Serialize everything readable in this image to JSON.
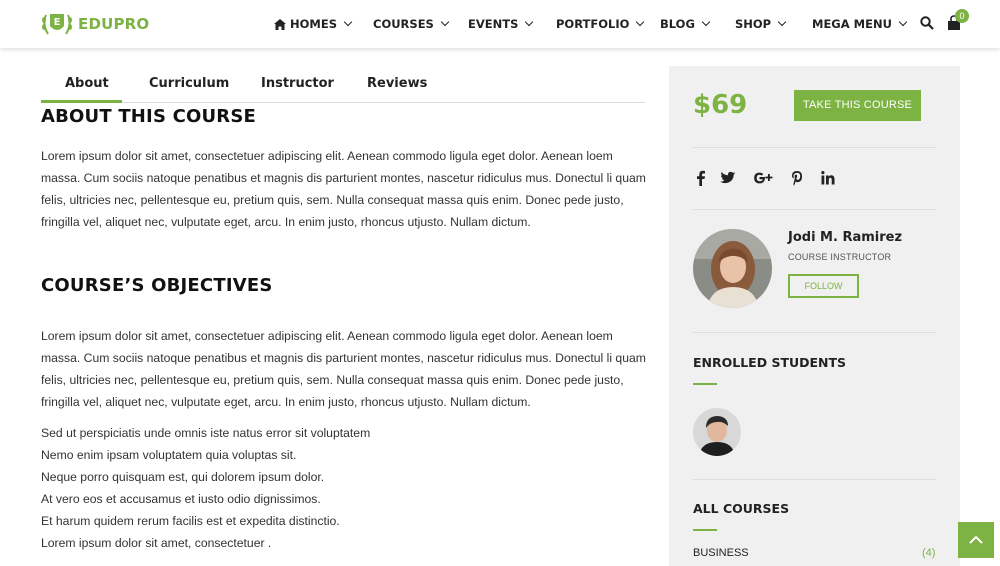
{
  "header": {
    "logo_text": "EDUPRO",
    "logo_letter": "E",
    "nav": [
      {
        "label": "HOMES"
      },
      {
        "label": "COURSES"
      },
      {
        "label": "EVENTS"
      },
      {
        "label": "PORTFOLIO"
      },
      {
        "label": "BLOG"
      },
      {
        "label": "SHOP"
      },
      {
        "label": "MEGA MENU"
      }
    ],
    "cart_count": "0"
  },
  "tabs": [
    "About",
    "Curriculum",
    "Instructor",
    "Reviews"
  ],
  "active_tab": "About",
  "main": {
    "about_title": "ABOUT THIS COURSE",
    "about_text": "Lorem ipsum dolor sit amet, consectetuer adipiscing elit. Aenean commodo ligula eget dolor. Aenean loem massa. Cum sociis natoque penatibus et magnis dis parturient montes, nascetur ridiculus mus. Donectul li quam felis, ultricies nec, pellentesque eu, pretium quis, sem. Nulla consequat massa quis enim. Donec pede justo, fringilla vel, aliquet nec, vulputate eget, arcu. In enim justo, rhoncus utjusto. Nullam dictum.",
    "objectives_title": "COURSE’S OBJECTIVES",
    "objectives_text": "Lorem ipsum dolor sit amet, consectetuer adipiscing elit. Aenean commodo ligula eget dolor. Aenean loem massa. Cum sociis natoque penatibus et magnis dis parturient montes, nascetur ridiculus mus. Donectul li quam felis, ultricies nec, pellentesque eu, pretium quis, sem. Nulla consequat massa quis enim. Donec pede justo, fringilla vel, aliquet nec, vulputate eget, arcu. In enim justo, rhoncus utjusto. Nullam dictum.",
    "list": [
      "Sed ut perspiciatis unde omnis iste natus error sit voluptatem",
      "Nemo enim ipsam voluptatem quia voluptas sit.",
      "Neque porro quisquam est, qui dolorem ipsum dolor.",
      "At vero eos et accusamus et iusto odio dignissimos.",
      "Et harum quidem rerum facilis est et expedita distinctio.",
      "Lorem ipsum dolor sit amet, consectetuer ."
    ]
  },
  "sidebar": {
    "price": "$69",
    "take_course_label": "TAKE THIS COURSE",
    "social": [
      "facebook-icon",
      "twitter-icon",
      "google-plus-icon",
      "pinterest-icon",
      "linkedin-icon"
    ],
    "instructor": {
      "name": "Jodi M. Ramirez",
      "role": "COURSE INSTRUCTOR",
      "follow_label": "FOLLOW"
    },
    "enrolled_title": "ENROLLED STUDENTS",
    "all_courses_title": "ALL COURSES",
    "courses": [
      {
        "name": "BUSINESS",
        "count": "(4)"
      }
    ]
  },
  "colors": {
    "accent": "#7cb342",
    "sidebar_bg": "#f0f0f0"
  }
}
